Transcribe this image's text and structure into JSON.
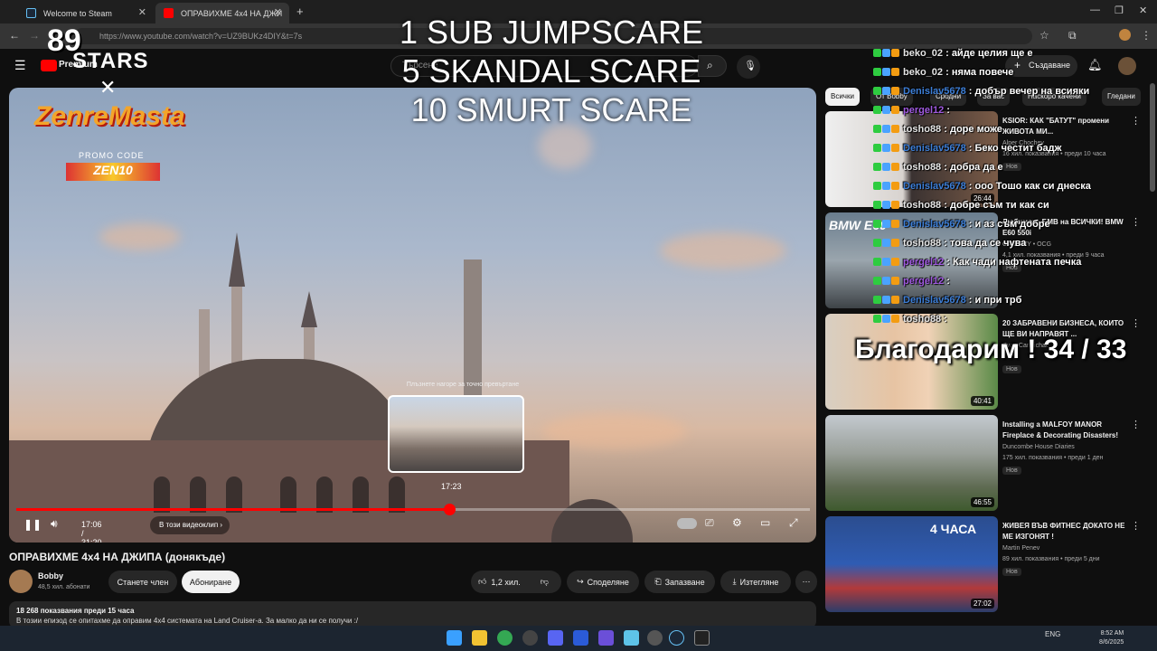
{
  "browser": {
    "tabs": [
      {
        "label": "Welcome to Steam",
        "active": false
      },
      {
        "label": "ОПРАВИХМЕ 4x4 НА ДЖИ",
        "active": true
      }
    ],
    "new_tab": "+",
    "url": "https://www.youtube.com/watch?v=UZ9BUKz4DIY&t=7s"
  },
  "header": {
    "logo_text": "Premium",
    "search_placeholder": "Търсене",
    "create_label": "Създаване"
  },
  "overlay": {
    "logo_number": "89",
    "logo_word": "STARS",
    "logo_x": "✕",
    "sponsor": "ZenreMasta",
    "promo_label": "PROMO CODE",
    "promo_code": "ZEN10",
    "alerts": [
      "1 SUB JUMPSCARE",
      "5 SKANDAL SCARE",
      "10 SMURT SCARE"
    ],
    "goal": "Благодарим ! 34 / 33"
  },
  "chat": [
    {
      "user": "beko_02",
      "color": "#e6e6e6",
      "text": "айде целия ще е"
    },
    {
      "user": "beko_02",
      "color": "#e6e6e6",
      "text": "няма повече"
    },
    {
      "user": "Denislav5678",
      "color": "#3d7fd8",
      "text": "добър вечер на всияки"
    },
    {
      "user": "pergel12",
      "color": "#a05ae0",
      "text": ""
    },
    {
      "user": "tosho88",
      "color": "#e6e6e6",
      "text": "доре може"
    },
    {
      "user": "Denislav5678",
      "color": "#3d7fd8",
      "text": "Беко честит бадж"
    },
    {
      "user": "tosho88",
      "color": "#e6e6e6",
      "text": "добра да е"
    },
    {
      "user": "Denislav5678",
      "color": "#3d7fd8",
      "text": "ооо Тошо как си днеска"
    },
    {
      "user": "tosho88",
      "color": "#e6e6e6",
      "text": "добре съм ти как си"
    },
    {
      "user": "Denislav5678",
      "color": "#3d7fd8",
      "text": "и аз съм добре"
    },
    {
      "user": "tosho88",
      "color": "#e6e6e6",
      "text": "това да се чува"
    },
    {
      "user": "pergel12",
      "color": "#a05ae0",
      "text": "Как чади нафтената печка"
    },
    {
      "user": "pergel12",
      "color": "#a05ae0",
      "text": ""
    },
    {
      "user": "Denislav5678",
      "color": "#3d7fd8",
      "text": "и при трб"
    },
    {
      "user": "tosho88",
      "color": "#e6e6e6",
      "text": ""
    }
  ],
  "player": {
    "preview_tip": "Плъзнете нагоре за точно превъртане",
    "preview_time": "17:23",
    "time": "17:06 / 31:20",
    "chapter": "В този видеоклип",
    "progress": 0.545,
    "accent": "#ff0000"
  },
  "video": {
    "title": "ОПРАВИХМЕ 4x4 НА ДЖИПА (донякъде)",
    "channel": "Bobby",
    "subs": "48,5 хил. абонати",
    "join": "Станете член",
    "subscribe": "Абониране",
    "likes": "1,2 хил.",
    "share": "Споделяне",
    "save": "Запазване",
    "download": "Изтегляне",
    "more": "⋯",
    "desc_stats": "18 268 показвания  преди 15 часа",
    "desc_text": "В тозии епизод се опитахме да оправим 4x4 системата на Land Cruiser-а. За малко да ни се получи :/"
  },
  "sidebar": {
    "chips": [
      "Всички",
      "От Bobby",
      "Сродни",
      "За вас",
      "Наскоро качени",
      "Гледани"
    ],
    "recs": [
      {
        "title": "KSIOR: КАК \"БАТУТ\" промени ЖИВОТА МИ...",
        "channel": "Alper Chochev",
        "meta": "16 хил. показвания • преди 10 часа",
        "badge": "Нов",
        "duration": "26:44"
      },
      {
        "title": "Любимото БМВ на ВСИЧКИ! BMW E60 550i",
        "channel": "CAR GUY • OCG",
        "meta": "4,1 хил. показвания • преди 9 часа",
        "badge": "Нов",
        "duration": ""
      },
      {
        "title": "20 ЗАБРАВЕНИ БИЗНЕСА, КОИТО ЩЕ ВИ НАПРАВЯТ ...",
        "channel": "Evan Carmichael",
        "meta": "",
        "badge": "Нов",
        "duration": "40:41"
      },
      {
        "title": "Installing a MALFOY MANOR Fireplace & Decorating Disasters!",
        "channel": "Duncombe House Diaries",
        "meta": "175 хил. показвания • преди 1 ден",
        "badge": "Нов",
        "duration": "46:55"
      },
      {
        "title": "ЖИВЕЯ ВЪВ ФИТНЕС ДОКАТО НЕ МЕ ИЗГОНЯТ !",
        "channel": "Martin Penev",
        "meta": "89 хил. показвания • преди 5 дни",
        "badge": "Нов",
        "duration": "27:02"
      }
    ],
    "rec2_overlay": "BMW E60",
    "rec5_overlay": "4 ЧАСА"
  },
  "taskbar": {
    "lang": "ENG",
    "time": "8:52 AM",
    "date": "8/6/2025"
  }
}
